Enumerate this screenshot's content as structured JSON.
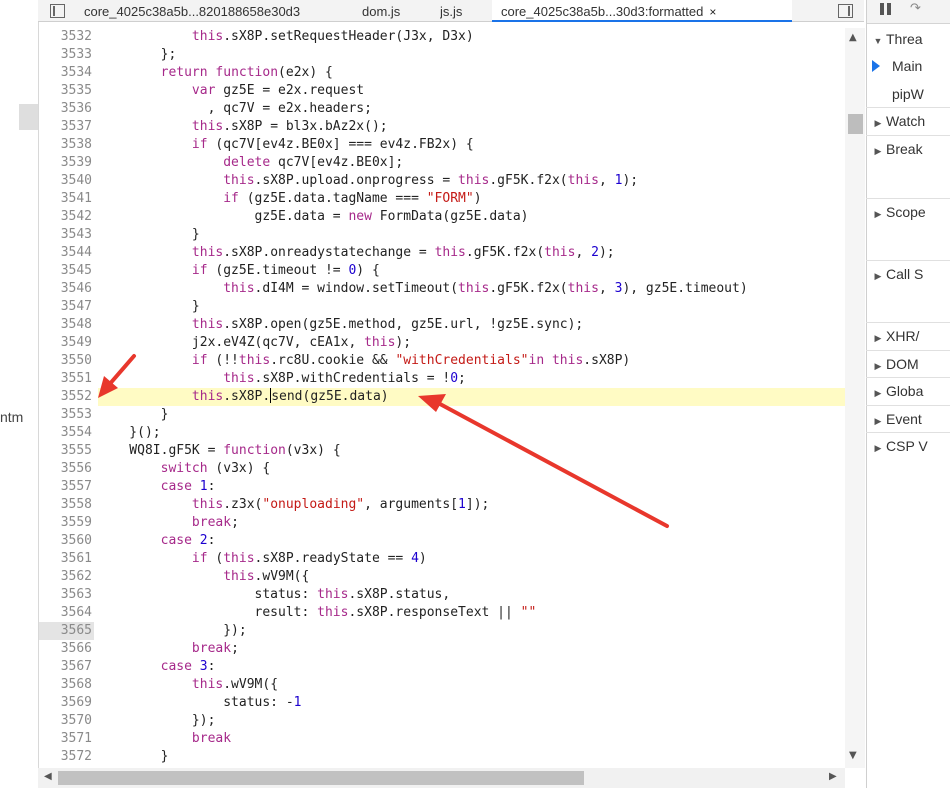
{
  "tabs": [
    {
      "label": "core_4025c38a5b...820188658e30d3",
      "active": false
    },
    {
      "label": "dom.js",
      "active": false
    },
    {
      "label": "js.js",
      "active": false
    },
    {
      "label": "core_4025c38a5b...30d3:formatted",
      "active": true,
      "close": "×"
    }
  ],
  "left_panel": {
    "partial_label": "ntm"
  },
  "code_lines": [
    {
      "n": "3532",
      "html": "            <span class=\"kw\">this</span>.sX8P.setRequestHeader(J3x, D3x)"
    },
    {
      "n": "3533",
      "html": "        };"
    },
    {
      "n": "3534",
      "html": "        <span class=\"kw\">return</span> <span class=\"kw\">function</span>(e2x) {"
    },
    {
      "n": "3535",
      "html": "            <span class=\"kw\">var</span> gz5E = e2x.request"
    },
    {
      "n": "3536",
      "html": "              , qc7V = e2x.headers;"
    },
    {
      "n": "3537",
      "html": "            <span class=\"kw\">this</span>.sX8P = bl3x.bAz2x();"
    },
    {
      "n": "3538",
      "html": "            <span class=\"kw\">if</span> (qc7V[ev4z.BE0x] === ev4z.FB2x) {"
    },
    {
      "n": "3539",
      "html": "                <span class=\"kw\">delete</span> qc7V[ev4z.BE0x];"
    },
    {
      "n": "3540",
      "html": "                <span class=\"kw\">this</span>.sX8P.upload.onprogress = <span class=\"kw\">this</span>.gF5K.f2x(<span class=\"kw\">this</span>, <span class=\"num\">1</span>);"
    },
    {
      "n": "3541",
      "html": "                <span class=\"kw\">if</span> (gz5E.data.tagName === <span class=\"str\">\"FORM\"</span>)"
    },
    {
      "n": "3542",
      "html": "                    gz5E.data = <span class=\"kw\">new</span> FormData(gz5E.data)"
    },
    {
      "n": "3543",
      "html": "            }"
    },
    {
      "n": "3544",
      "html": "            <span class=\"kw\">this</span>.sX8P.onreadystatechange = <span class=\"kw\">this</span>.gF5K.f2x(<span class=\"kw\">this</span>, <span class=\"num\">2</span>);"
    },
    {
      "n": "3545",
      "html": "            <span class=\"kw\">if</span> (gz5E.timeout != <span class=\"num\">0</span>) {"
    },
    {
      "n": "3546",
      "html": "                <span class=\"kw\">this</span>.dI4M = window.setTimeout(<span class=\"kw\">this</span>.gF5K.f2x(<span class=\"kw\">this</span>, <span class=\"num\">3</span>), gz5E.timeout)"
    },
    {
      "n": "3547",
      "html": "            }"
    },
    {
      "n": "3548",
      "html": "            <span class=\"kw\">this</span>.sX8P.open(gz5E.method, gz5E.url, !gz5E.sync);"
    },
    {
      "n": "3549",
      "html": "            j2x.eV4Z(qc7V, cEA1x, <span class=\"kw\">this</span>);"
    },
    {
      "n": "3550",
      "html": "            <span class=\"kw\">if</span> (!!<span class=\"kw\">this</span>.rc8U.cookie &amp;&amp; <span class=\"str\">\"withCredentials\"</span><span class=\"kw\">in</span> <span class=\"kw\">this</span>.sX8P)"
    },
    {
      "n": "3551",
      "html": "                <span class=\"kw\">this</span>.sX8P.withCredentials = !<span class=\"num\">0</span>;"
    },
    {
      "n": "3552",
      "html": "            <span class=\"kw\">this</span>.sX8P.<span class=\"caret\"></span>send(gz5E.data)",
      "current": true
    },
    {
      "n": "3553",
      "html": "        }"
    },
    {
      "n": "3554",
      "html": "    }();"
    },
    {
      "n": "3555",
      "html": "    WQ8I.gF5K = <span class=\"kw\">function</span>(v3x) {"
    },
    {
      "n": "3556",
      "html": "        <span class=\"kw\">switch</span> (v3x) {"
    },
    {
      "n": "3557",
      "html": "        <span class=\"kw\">case</span> <span class=\"num\">1</span>:"
    },
    {
      "n": "3558",
      "html": "            <span class=\"kw\">this</span>.z3x(<span class=\"str\">\"onuploading\"</span>, arguments[<span class=\"num\">1</span>]);"
    },
    {
      "n": "3559",
      "html": "            <span class=\"kw\">break</span>;"
    },
    {
      "n": "3560",
      "html": "        <span class=\"kw\">case</span> <span class=\"num\">2</span>:"
    },
    {
      "n": "3561",
      "html": "            <span class=\"kw\">if</span> (<span class=\"kw\">this</span>.sX8P.readyState == <span class=\"num\">4</span>)"
    },
    {
      "n": "3562",
      "html": "                <span class=\"kw\">this</span>.wV9M({"
    },
    {
      "n": "3563",
      "html": "                    status: <span class=\"kw\">this</span>.sX8P.status,"
    },
    {
      "n": "3564",
      "html": "                    result: <span class=\"kw\">this</span>.sX8P.responseText || <span class=\"str\">\"\"</span>"
    },
    {
      "n": "3565",
      "html": "                });",
      "gutter_highlight": true
    },
    {
      "n": "3566",
      "html": "            <span class=\"kw\">break</span>;"
    },
    {
      "n": "3567",
      "html": "        <span class=\"kw\">case</span> <span class=\"num\">3</span>:"
    },
    {
      "n": "3568",
      "html": "            <span class=\"kw\">this</span>.wV9M({"
    },
    {
      "n": "3569",
      "html": "                status: -<span class=\"num\">1</span>"
    },
    {
      "n": "3570",
      "html": "            });"
    },
    {
      "n": "3571",
      "html": "            <span class=\"kw\">break</span>"
    },
    {
      "n": "3572",
      "html": "        }"
    }
  ],
  "right_panel": {
    "threads_label": "Threa",
    "main_label": "Main",
    "pip_label": "pipW",
    "sections": [
      "Watch",
      "Break",
      "Scope",
      "Call S",
      "XHR/",
      "DOM",
      "Globa",
      "Event",
      "CSP V"
    ]
  },
  "colors": {
    "keyword": "#a6298a",
    "string": "#c41a16",
    "number": "#1c00cf",
    "current_line": "#fffbc4",
    "arrow": "#e8372c"
  }
}
